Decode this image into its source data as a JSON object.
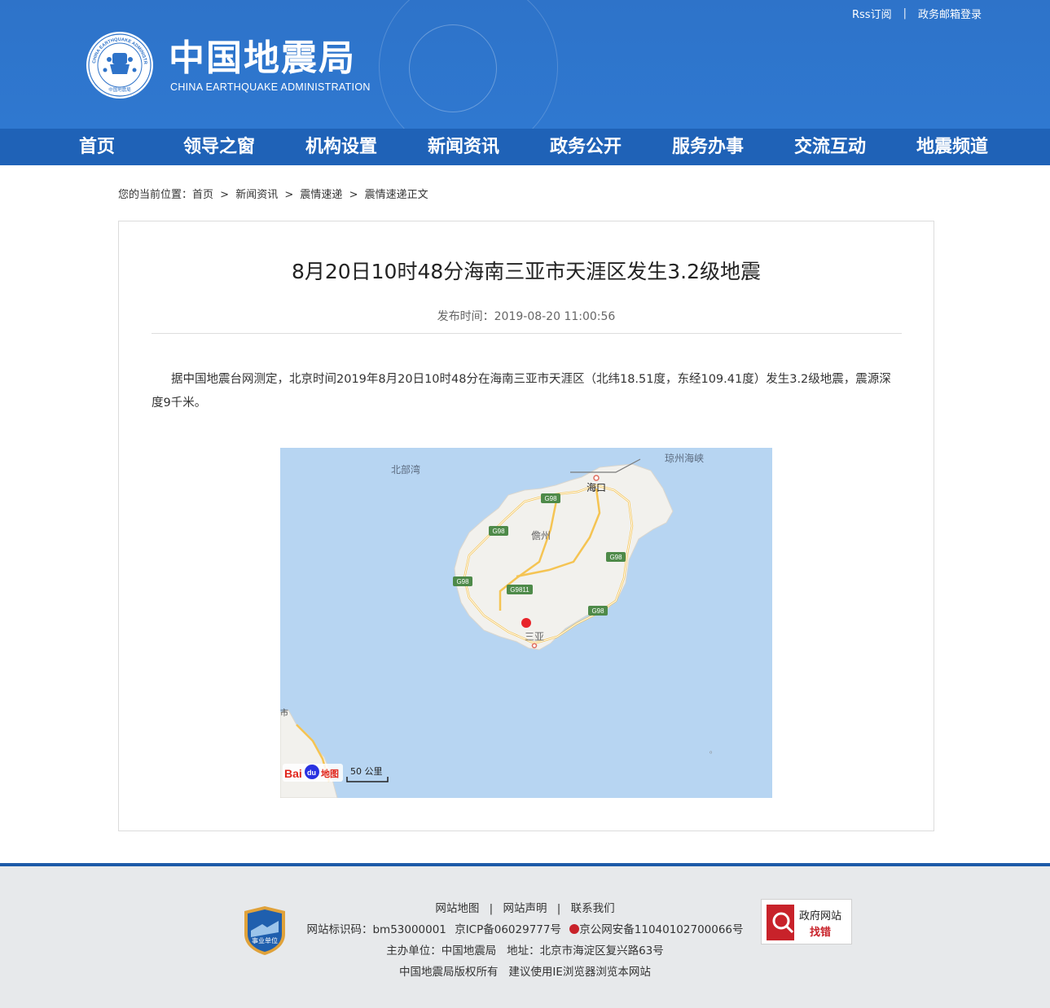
{
  "header": {
    "logo_cn": "中国地震局",
    "logo_en": "CHINA EARTHQUAKE ADMINISTRATION",
    "emblem_ring_text": "CHINA EARTHQUAKE ADMINISTRATION",
    "emblem_bottom_text": "中国地震局",
    "links": [
      "Rss订阅",
      "政务邮箱登录"
    ],
    "sep": "|"
  },
  "nav": {
    "items": [
      "首页",
      "领导之窗",
      "机构设置",
      "新闻资讯",
      "政务公开",
      "服务办事",
      "交流互动",
      "地震频道"
    ]
  },
  "breadcrumb": {
    "prefix": "您的当前位置：",
    "items": [
      "首页",
      "新闻资讯",
      "震情速递",
      "震情速递正文"
    ],
    "sep": ">"
  },
  "article": {
    "title": "8月20日10时48分海南三亚市天涯区发生3.2级地震",
    "pubtime": "发布时间：2019-08-20 11:00:56",
    "body": "据中国地震台网测定，北京时间2019年8月20日10时48分在海南三亚市天涯区（北纬18.51度，东经109.41度）发生3.2级地震，震源深度9千米。"
  },
  "map": {
    "labels": {
      "gulf": "北部湾",
      "strait": "琼州海峡",
      "haikou": "海口",
      "danzhou": "儋州",
      "sanya": "三亚",
      "city_partial": "市"
    },
    "road_labels": [
      "G98",
      "G98",
      "G98",
      "G98",
      "G9811",
      "G98"
    ],
    "scale": "50 公里",
    "brand": "Bai",
    "brand_du": "du",
    "brand_suffix": "地图",
    "colors": {
      "sea": "#b7d5f2",
      "land": "#f2f1ed",
      "road": "#f5c453",
      "marker": "#e8242a"
    }
  },
  "footer": {
    "links": [
      "网站地图",
      "网站声明",
      "联系我们"
    ],
    "sep": "|",
    "line2_a": "网站标识码：bm53000001",
    "line2_b": "京ICP备06029777号",
    "line2_c": "京公网安备11040102700066号",
    "line3": "主办单位：中国地震局   地址：北京市海淀区复兴路63号",
    "line4": "中国地震局版权所有   建议使用IE浏览器浏览本网站",
    "badge_left": "事业单位",
    "badge_right_top": "政府网站",
    "badge_right_bottom": "找错"
  }
}
